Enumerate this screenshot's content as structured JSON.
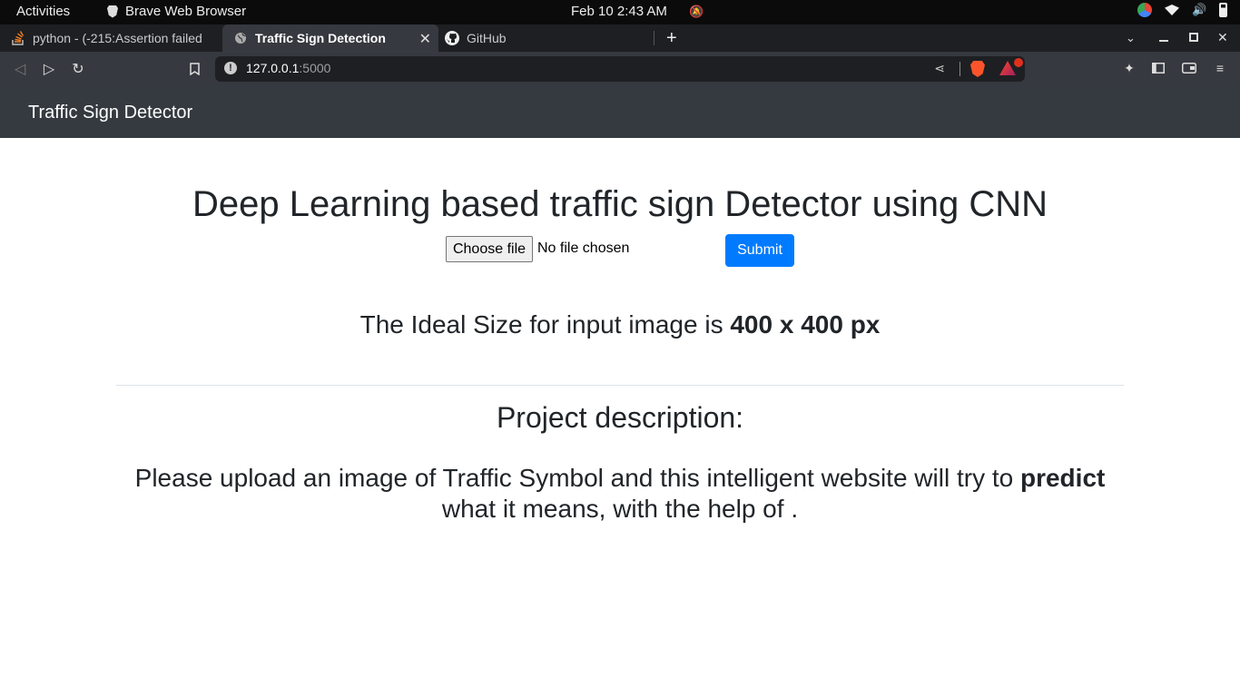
{
  "system": {
    "activities": "Activities",
    "app_name": "Brave Web Browser",
    "clock": "Feb 10  2:43 AM"
  },
  "tabs": [
    {
      "label": "python - (-215:Assertion failed",
      "icon": "stackoverflow-icon"
    },
    {
      "label": "Traffic Sign Detection",
      "icon": "globe-icon",
      "active": true
    },
    {
      "label": "GitHub",
      "icon": "github-icon"
    }
  ],
  "address_bar": {
    "host": "127.0.0.1",
    "port": ":5000"
  },
  "page": {
    "brand": "Traffic Sign Detector",
    "heading": "Deep Learning based traffic sign Detector using CNN",
    "file_button": "Choose file",
    "file_status": "No file chosen",
    "submit_label": "Submit",
    "ideal_prefix": "The Ideal Size for input image is ",
    "ideal_size": "400 x 400 px",
    "description_heading": "Project description:",
    "description_before": "Please upload an image of Traffic Symbol and this intelligent website will try to ",
    "description_bold": "predict",
    "description_after": " what it means, with the help of ."
  },
  "colors": {
    "navbar_bg": "#343a40",
    "submit_bg": "#007bff",
    "browser_chrome": "#36393f"
  }
}
